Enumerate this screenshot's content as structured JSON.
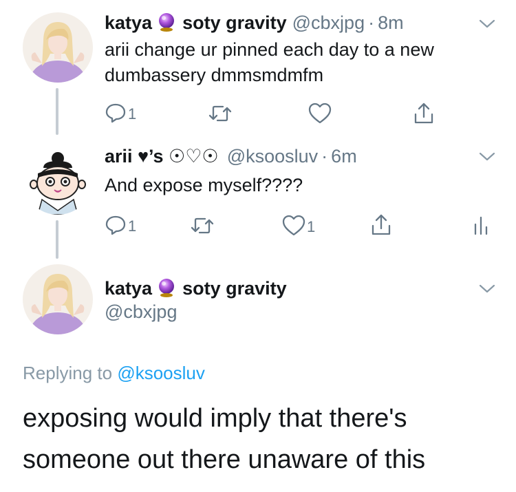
{
  "tweets": [
    {
      "name": "katya",
      "name_suffix": "soty gravity",
      "handle": "@cbxjpg",
      "dot": "·",
      "time": "8m",
      "text_lines": [
        "arii change ur pinned each day to a new",
        "dumbassery dmmsmdmfm"
      ],
      "reply_count": "1",
      "retweet_count": "",
      "like_count": ""
    },
    {
      "name": "arii ♥’s ☉♡☉",
      "handle": "@ksoosluv",
      "dot": "·",
      "time": "6m",
      "text": "And expose myself????",
      "reply_count": "1",
      "retweet_count": "",
      "like_count": "1"
    }
  ],
  "focused": {
    "name": "katya",
    "name_suffix": "soty gravity",
    "handle": "@cbxjpg",
    "replying_prefix": "Replying to",
    "replying_mention": "@ksoosluv",
    "text_lines": [
      "exposing would imply that there's",
      "someone out there unaware of this"
    ]
  },
  "icons": {
    "reply": "reply-icon",
    "retweet": "retweet-icon",
    "like": "heart-icon",
    "share": "share-icon",
    "analytics": "analytics-icon",
    "caret": "chevron-down-icon",
    "orb": "crystal-ball-emoji"
  },
  "colors": {
    "text": "#14171a",
    "secondary": "#657786",
    "link": "#1da1f2",
    "thread_line": "#c5ccd3"
  }
}
